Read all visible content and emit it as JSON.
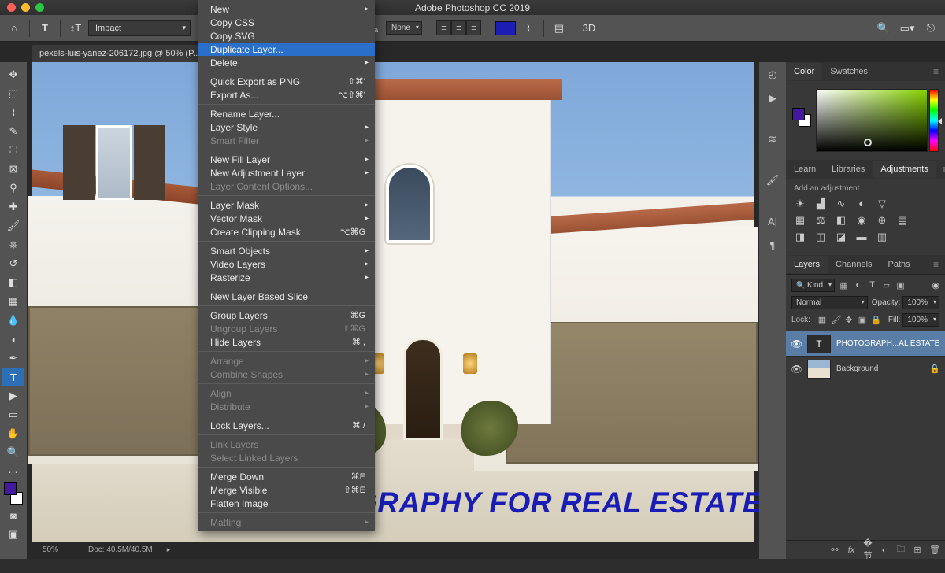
{
  "app": {
    "title": "Adobe Photoshop CC 2019"
  },
  "doc": {
    "tab": "pexels-luis-yanez-206172.jpg @ 50% (P...",
    "zoom": "50%",
    "docsize": "Doc: 40.5M/40.5M"
  },
  "options": {
    "font": "Impact",
    "aa_label": "aₐ",
    "aa_value": "None",
    "threeD": "3D"
  },
  "watermark": "PHOTOGRAPHY FOR REAL ESTATE",
  "panels": {
    "color_tab": "Color",
    "swatches_tab": "Swatches",
    "learn_tab": "Learn",
    "libraries_tab": "Libraries",
    "adjustments_tab": "Adjustments",
    "add_adj": "Add an adjustment",
    "layers_tab": "Layers",
    "channels_tab": "Channels",
    "paths_tab": "Paths",
    "kind_label": "Kind",
    "blend_mode": "Normal",
    "opacity_label": "Opacity:",
    "opacity_val": "100%",
    "lock_label": "Lock:",
    "fill_label": "Fill:",
    "fill_val": "100%",
    "layer1": "PHOTOGRAPH...AL ESTATE",
    "layer2": "Background"
  },
  "menu": {
    "items": [
      {
        "t": "New",
        "arr": true
      },
      {
        "t": "Copy CSS"
      },
      {
        "t": "Copy SVG"
      },
      {
        "t": "Duplicate Layer...",
        "hl": true
      },
      {
        "t": "Delete",
        "arr": true
      },
      {
        "sep": true
      },
      {
        "t": "Quick Export as PNG",
        "sc": "⇧⌘'"
      },
      {
        "t": "Export As...",
        "sc": "⌥⇧⌘'"
      },
      {
        "sep": true
      },
      {
        "t": "Rename Layer..."
      },
      {
        "t": "Layer Style",
        "arr": true
      },
      {
        "t": "Smart Filter",
        "dis": true,
        "arr": true
      },
      {
        "sep": true
      },
      {
        "t": "New Fill Layer",
        "arr": true
      },
      {
        "t": "New Adjustment Layer",
        "arr": true
      },
      {
        "t": "Layer Content Options...",
        "dis": true
      },
      {
        "sep": true
      },
      {
        "t": "Layer Mask",
        "arr": true
      },
      {
        "t": "Vector Mask",
        "arr": true
      },
      {
        "t": "Create Clipping Mask",
        "sc": "⌥⌘G"
      },
      {
        "sep": true
      },
      {
        "t": "Smart Objects",
        "arr": true
      },
      {
        "t": "Video Layers",
        "arr": true
      },
      {
        "t": "Rasterize",
        "arr": true
      },
      {
        "sep": true
      },
      {
        "t": "New Layer Based Slice"
      },
      {
        "sep": true
      },
      {
        "t": "Group Layers",
        "sc": "⌘G"
      },
      {
        "t": "Ungroup Layers",
        "dis": true,
        "sc": "⇧⌘G"
      },
      {
        "t": "Hide Layers",
        "sc": "⌘ ,"
      },
      {
        "sep": true
      },
      {
        "t": "Arrange",
        "dis": true,
        "arr": true
      },
      {
        "t": "Combine Shapes",
        "dis": true,
        "arr": true
      },
      {
        "sep": true
      },
      {
        "t": "Align",
        "dis": true,
        "arr": true
      },
      {
        "t": "Distribute",
        "dis": true,
        "arr": true
      },
      {
        "sep": true
      },
      {
        "t": "Lock Layers...",
        "sc": "⌘ /"
      },
      {
        "sep": true
      },
      {
        "t": "Link Layers",
        "dis": true
      },
      {
        "t": "Select Linked Layers",
        "dis": true
      },
      {
        "sep": true
      },
      {
        "t": "Merge Down",
        "sc": "⌘E"
      },
      {
        "t": "Merge Visible",
        "sc": "⇧⌘E"
      },
      {
        "t": "Flatten Image"
      },
      {
        "sep": true
      },
      {
        "t": "Matting",
        "dis": true,
        "arr": true
      }
    ]
  }
}
